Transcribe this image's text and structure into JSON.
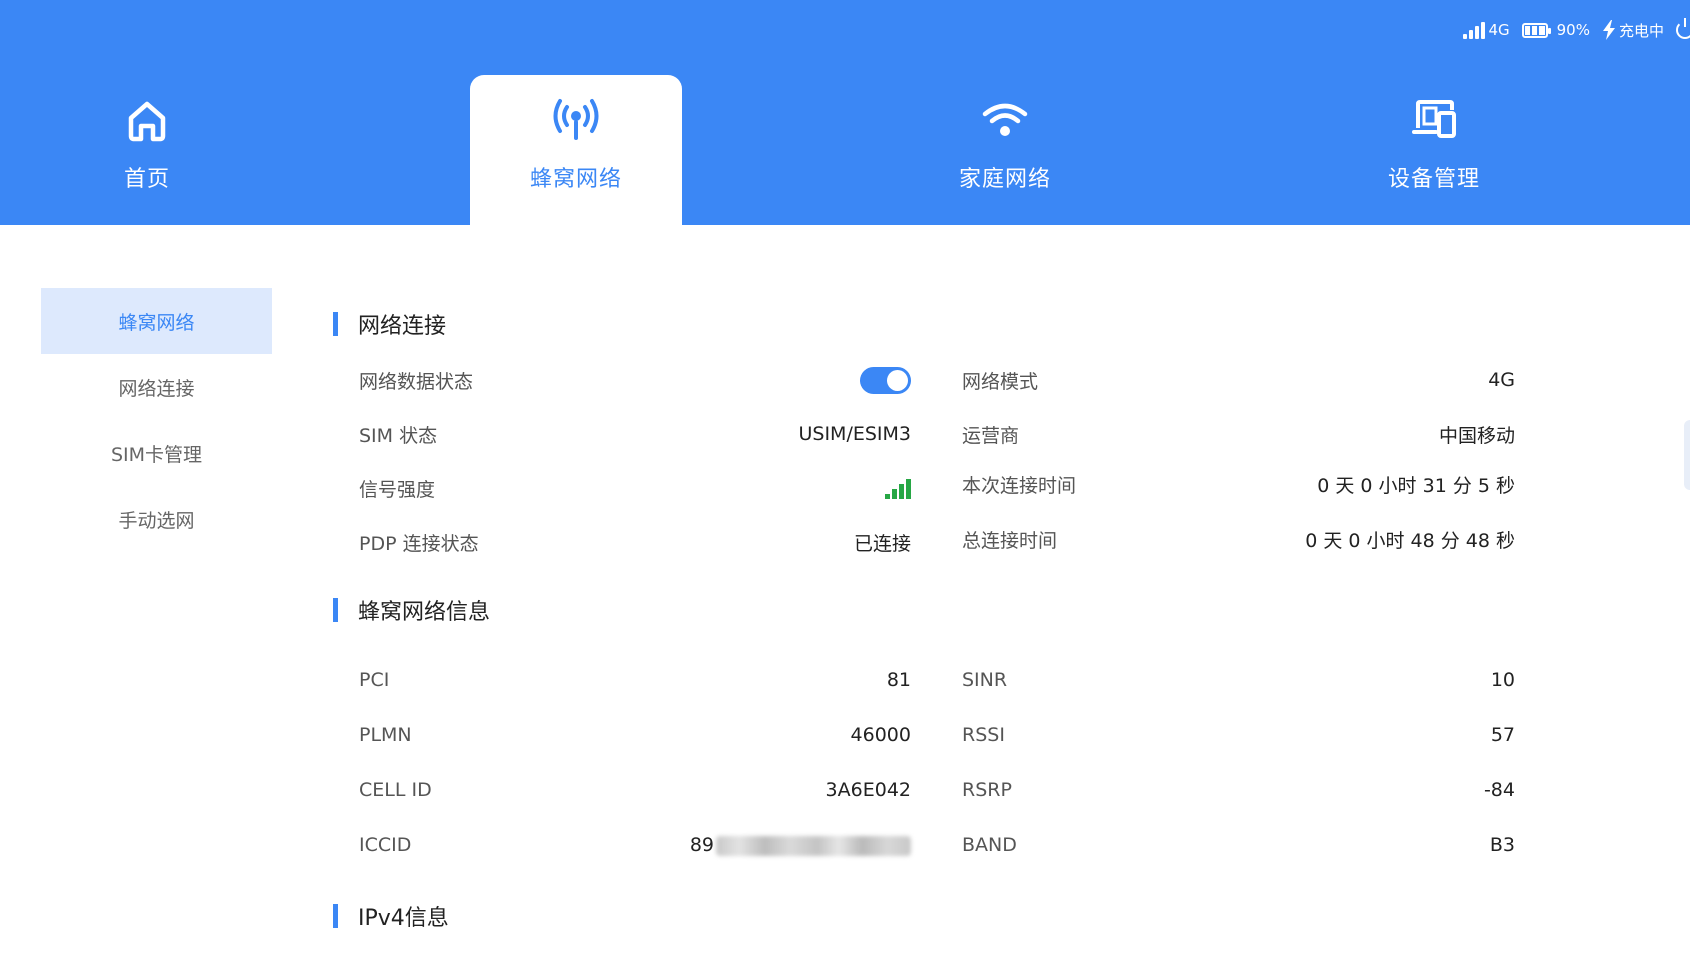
{
  "status_bar": {
    "network_type": "4G",
    "battery_percent": "90%",
    "charging_label": "充电中"
  },
  "tabs": [
    {
      "label": "首页",
      "icon": "home-icon",
      "active": false
    },
    {
      "label": "蜂窝网络",
      "icon": "cellular-antenna-icon",
      "active": true
    },
    {
      "label": "家庭网络",
      "icon": "wifi-icon",
      "active": false
    },
    {
      "label": "设备管理",
      "icon": "devices-icon",
      "active": false
    }
  ],
  "sidebar": {
    "items": [
      {
        "label": "蜂窝网络",
        "active": true
      },
      {
        "label": "网络连接",
        "active": false
      },
      {
        "label": "SIM卡管理",
        "active": false
      },
      {
        "label": "手动选网",
        "active": false
      }
    ]
  },
  "sections": {
    "connection": {
      "title": "网络连接",
      "data_status_label": "网络数据状态",
      "data_status_on": true,
      "sim_status_label": "SIM 状态",
      "sim_status_value": "USIM/ESIM3",
      "signal_label": "信号强度",
      "signal_bars": 4,
      "pdp_label": "PDP 连接状态",
      "pdp_value": "已连接",
      "mode_label": "网络模式",
      "mode_value": "4G",
      "carrier_label": "运营商",
      "carrier_value": "中国移动",
      "session_time_label": "本次连接时间",
      "session_time_value": "0 天 0 小时 31 分 5 秒",
      "total_time_label": "总连接时间",
      "total_time_value": "0 天 0 小时 48 分 48 秒"
    },
    "cell_info": {
      "title": "蜂窝网络信息",
      "pci_label": "PCI",
      "pci_value": "81",
      "plmn_label": "PLMN",
      "plmn_value": "46000",
      "cellid_label": "CELL ID",
      "cellid_value": "3A6E042",
      "iccid_label": "ICCID",
      "iccid_prefix": "89",
      "sinr_label": "SINR",
      "sinr_value": "10",
      "rssi_label": "RSSI",
      "rssi_value": "57",
      "rsrp_label": "RSRP",
      "rsrp_value": "-84",
      "band_label": "BAND",
      "band_value": "B3"
    },
    "ipv4": {
      "title": "IPv4信息"
    }
  },
  "colors": {
    "accent": "#3b87f5",
    "active_bg": "#dde9fd",
    "signal_green": "#27a745"
  }
}
